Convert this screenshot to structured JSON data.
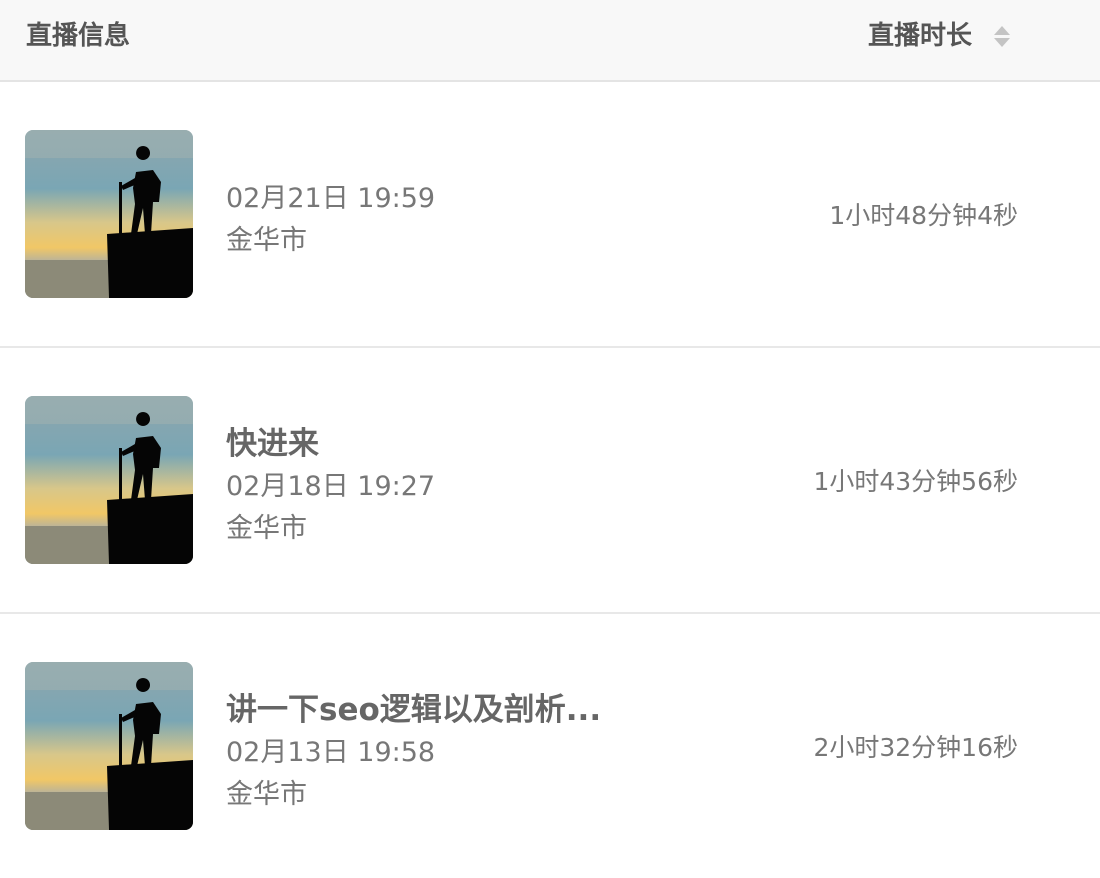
{
  "header": {
    "info_label": "直播信息",
    "duration_label": "直播时长"
  },
  "rows": [
    {
      "title": "",
      "date": "02月21日 19:59",
      "city": "金华市",
      "duration": "1小时48分钟4秒"
    },
    {
      "title": "快进来",
      "date": "02月18日 19:27",
      "city": "金华市",
      "duration": "1小时43分钟56秒"
    },
    {
      "title": "讲一下seo逻辑以及剖析...",
      "date": "02月13日 19:58",
      "city": "金华市",
      "duration": "2小时32分钟16秒"
    }
  ],
  "icons": {
    "sort": "sort-icon",
    "thumbnail": "hiker-silhouette-sunset"
  },
  "colors": {
    "header_bg": "#f8f8f8",
    "divider": "#e8e8e8",
    "text": "#666666"
  }
}
